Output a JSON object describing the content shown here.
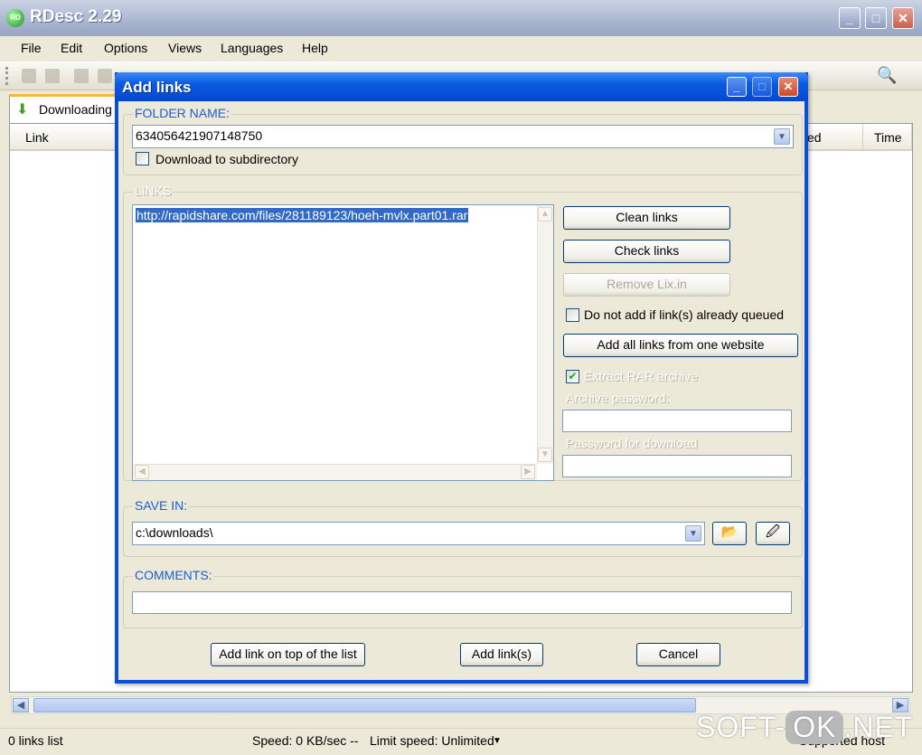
{
  "app": {
    "title": "RDesc 2.29",
    "icon_text": "RD",
    "menu": [
      "File",
      "Edit",
      "Options",
      "Views",
      "Languages",
      "Help"
    ]
  },
  "tabs": [
    {
      "label": "Downloading"
    }
  ],
  "list_columns": {
    "link": "Link",
    "speed_partial": "ed",
    "time": "Time"
  },
  "status": {
    "links": "0 links list",
    "speed": "Speed: 0 KB/sec  --",
    "limit": "Limit speed: Unlimited",
    "supported": "Supported host"
  },
  "watermark": {
    "pre": "SOFT-",
    "ok": "OK",
    "post": ".NET"
  },
  "dialog": {
    "title": "Add links",
    "folder_group": "FOLDER NAME:",
    "folder_value": "634056421907148750",
    "subdir_label": "Download to subdirectory",
    "links_group": "LINKS",
    "links_value": "http://rapidshare.com/files/281189123/hoeh-mvlx.part01.rar",
    "clean_links": "Clean links",
    "check_links": "Check links",
    "remove_lixin": "Remove Lix.in",
    "not_add_queued": "Do not add if link(s) already queued",
    "add_all_links": "Add all links from one website",
    "extract_rar": "Extract RAR archive",
    "extract_rar_checked": true,
    "archive_password": "Archive password:",
    "password_download": "Password for download",
    "save_group": "SAVE IN:",
    "save_value": "c:\\downloads\\",
    "comments_group": "COMMENTS:",
    "comments_value": "",
    "add_top": "Add link on top of the list",
    "add_links": "Add link(s)",
    "cancel": "Cancel"
  }
}
